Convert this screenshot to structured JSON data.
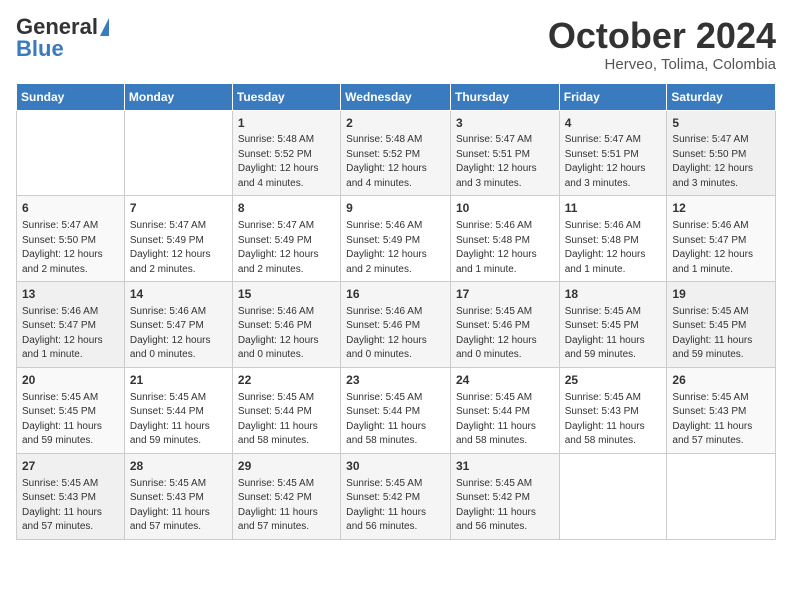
{
  "header": {
    "logo_general": "General",
    "logo_blue": "Blue",
    "month_title": "October 2024",
    "location": "Herveo, Tolima, Colombia"
  },
  "calendar": {
    "days_of_week": [
      "Sunday",
      "Monday",
      "Tuesday",
      "Wednesday",
      "Thursday",
      "Friday",
      "Saturday"
    ],
    "weeks": [
      [
        {
          "day": "",
          "info": ""
        },
        {
          "day": "",
          "info": ""
        },
        {
          "day": "1",
          "info": "Sunrise: 5:48 AM\nSunset: 5:52 PM\nDaylight: 12 hours and 4 minutes."
        },
        {
          "day": "2",
          "info": "Sunrise: 5:48 AM\nSunset: 5:52 PM\nDaylight: 12 hours and 4 minutes."
        },
        {
          "day": "3",
          "info": "Sunrise: 5:47 AM\nSunset: 5:51 PM\nDaylight: 12 hours and 3 minutes."
        },
        {
          "day": "4",
          "info": "Sunrise: 5:47 AM\nSunset: 5:51 PM\nDaylight: 12 hours and 3 minutes."
        },
        {
          "day": "5",
          "info": "Sunrise: 5:47 AM\nSunset: 5:50 PM\nDaylight: 12 hours and 3 minutes."
        }
      ],
      [
        {
          "day": "6",
          "info": "Sunrise: 5:47 AM\nSunset: 5:50 PM\nDaylight: 12 hours and 2 minutes."
        },
        {
          "day": "7",
          "info": "Sunrise: 5:47 AM\nSunset: 5:49 PM\nDaylight: 12 hours and 2 minutes."
        },
        {
          "day": "8",
          "info": "Sunrise: 5:47 AM\nSunset: 5:49 PM\nDaylight: 12 hours and 2 minutes."
        },
        {
          "day": "9",
          "info": "Sunrise: 5:46 AM\nSunset: 5:49 PM\nDaylight: 12 hours and 2 minutes."
        },
        {
          "day": "10",
          "info": "Sunrise: 5:46 AM\nSunset: 5:48 PM\nDaylight: 12 hours and 1 minute."
        },
        {
          "day": "11",
          "info": "Sunrise: 5:46 AM\nSunset: 5:48 PM\nDaylight: 12 hours and 1 minute."
        },
        {
          "day": "12",
          "info": "Sunrise: 5:46 AM\nSunset: 5:47 PM\nDaylight: 12 hours and 1 minute."
        }
      ],
      [
        {
          "day": "13",
          "info": "Sunrise: 5:46 AM\nSunset: 5:47 PM\nDaylight: 12 hours and 1 minute."
        },
        {
          "day": "14",
          "info": "Sunrise: 5:46 AM\nSunset: 5:47 PM\nDaylight: 12 hours and 0 minutes."
        },
        {
          "day": "15",
          "info": "Sunrise: 5:46 AM\nSunset: 5:46 PM\nDaylight: 12 hours and 0 minutes."
        },
        {
          "day": "16",
          "info": "Sunrise: 5:46 AM\nSunset: 5:46 PM\nDaylight: 12 hours and 0 minutes."
        },
        {
          "day": "17",
          "info": "Sunrise: 5:45 AM\nSunset: 5:46 PM\nDaylight: 12 hours and 0 minutes."
        },
        {
          "day": "18",
          "info": "Sunrise: 5:45 AM\nSunset: 5:45 PM\nDaylight: 11 hours and 59 minutes."
        },
        {
          "day": "19",
          "info": "Sunrise: 5:45 AM\nSunset: 5:45 PM\nDaylight: 11 hours and 59 minutes."
        }
      ],
      [
        {
          "day": "20",
          "info": "Sunrise: 5:45 AM\nSunset: 5:45 PM\nDaylight: 11 hours and 59 minutes."
        },
        {
          "day": "21",
          "info": "Sunrise: 5:45 AM\nSunset: 5:44 PM\nDaylight: 11 hours and 59 minutes."
        },
        {
          "day": "22",
          "info": "Sunrise: 5:45 AM\nSunset: 5:44 PM\nDaylight: 11 hours and 58 minutes."
        },
        {
          "day": "23",
          "info": "Sunrise: 5:45 AM\nSunset: 5:44 PM\nDaylight: 11 hours and 58 minutes."
        },
        {
          "day": "24",
          "info": "Sunrise: 5:45 AM\nSunset: 5:44 PM\nDaylight: 11 hours and 58 minutes."
        },
        {
          "day": "25",
          "info": "Sunrise: 5:45 AM\nSunset: 5:43 PM\nDaylight: 11 hours and 58 minutes."
        },
        {
          "day": "26",
          "info": "Sunrise: 5:45 AM\nSunset: 5:43 PM\nDaylight: 11 hours and 57 minutes."
        }
      ],
      [
        {
          "day": "27",
          "info": "Sunrise: 5:45 AM\nSunset: 5:43 PM\nDaylight: 11 hours and 57 minutes."
        },
        {
          "day": "28",
          "info": "Sunrise: 5:45 AM\nSunset: 5:43 PM\nDaylight: 11 hours and 57 minutes."
        },
        {
          "day": "29",
          "info": "Sunrise: 5:45 AM\nSunset: 5:42 PM\nDaylight: 11 hours and 57 minutes."
        },
        {
          "day": "30",
          "info": "Sunrise: 5:45 AM\nSunset: 5:42 PM\nDaylight: 11 hours and 56 minutes."
        },
        {
          "day": "31",
          "info": "Sunrise: 5:45 AM\nSunset: 5:42 PM\nDaylight: 11 hours and 56 minutes."
        },
        {
          "day": "",
          "info": ""
        },
        {
          "day": "",
          "info": ""
        }
      ]
    ]
  }
}
